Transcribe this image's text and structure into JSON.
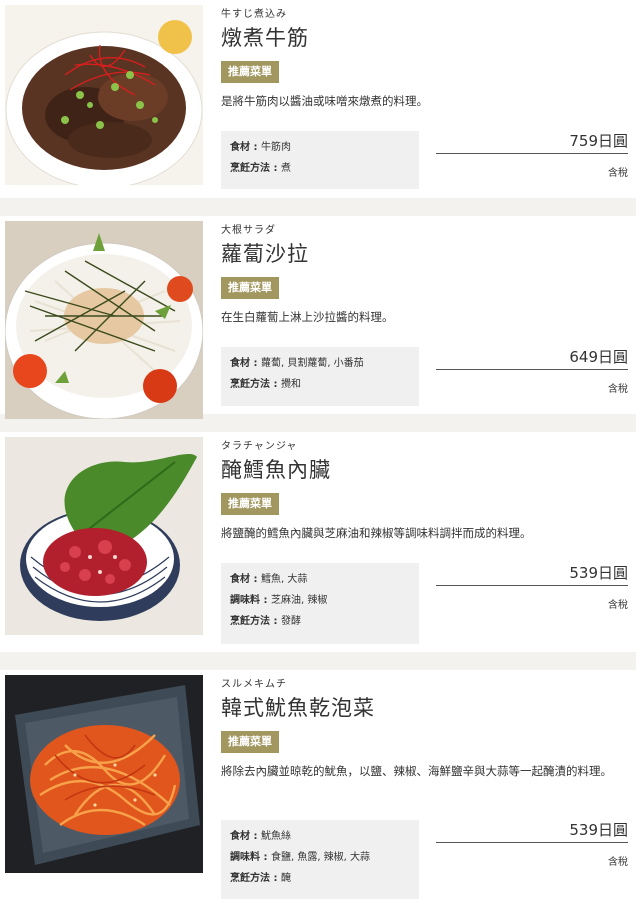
{
  "items": [
    {
      "sub": "牛すじ煮込み",
      "name": "燉煮牛筋",
      "badge": "推薦菜單",
      "desc": "是將牛筋肉以醬油或味噌來燉煮的料理。",
      "specs": [
        {
          "key": "食材 : ",
          "val": "牛筋肉"
        },
        {
          "key": "烹飪方法 : ",
          "val": "煮"
        }
      ],
      "price": "759日圓",
      "tax": "含稅"
    },
    {
      "sub": "大根サラダ",
      "name": "蘿蔔沙拉",
      "badge": "推薦菜單",
      "desc": "在生白蘿蔔上淋上沙拉醬的料理。",
      "specs": [
        {
          "key": "食材 : ",
          "val": "蘿蔔, 貝割蘿蔔, 小番茄"
        },
        {
          "key": "烹飪方法 : ",
          "val": "攪和"
        }
      ],
      "price": "649日圓",
      "tax": "含稅"
    },
    {
      "sub": "タラチャンジャ",
      "name": "醃鱈魚內臟",
      "badge": "推薦菜單",
      "desc": "將鹽醃的鱈魚內臟與芝麻油和辣椒等調味料調拌而成的料理。",
      "specs": [
        {
          "key": "食材 : ",
          "val": "鱈魚, 大蒜"
        },
        {
          "key": "調味料 : ",
          "val": "芝麻油, 辣椒"
        },
        {
          "key": "烹飪方法 : ",
          "val": "發酵"
        }
      ],
      "price": "539日圓",
      "tax": "含稅"
    },
    {
      "sub": "スルメキムチ",
      "name": "韓式魷魚乾泡菜",
      "badge": "推薦菜單",
      "desc": "將除去內臟並晾乾的魷魚，以鹽、辣椒、海鮮鹽辛與大蒜等一起醃漬的料理。",
      "specs": [
        {
          "key": "食材 : ",
          "val": "魷魚絲"
        },
        {
          "key": "調味料 : ",
          "val": "食鹽, 魚露, 辣椒, 大蒜"
        },
        {
          "key": "烹飪方法 : ",
          "val": "醃"
        }
      ],
      "price": "539日圓",
      "tax": "含稅"
    }
  ]
}
